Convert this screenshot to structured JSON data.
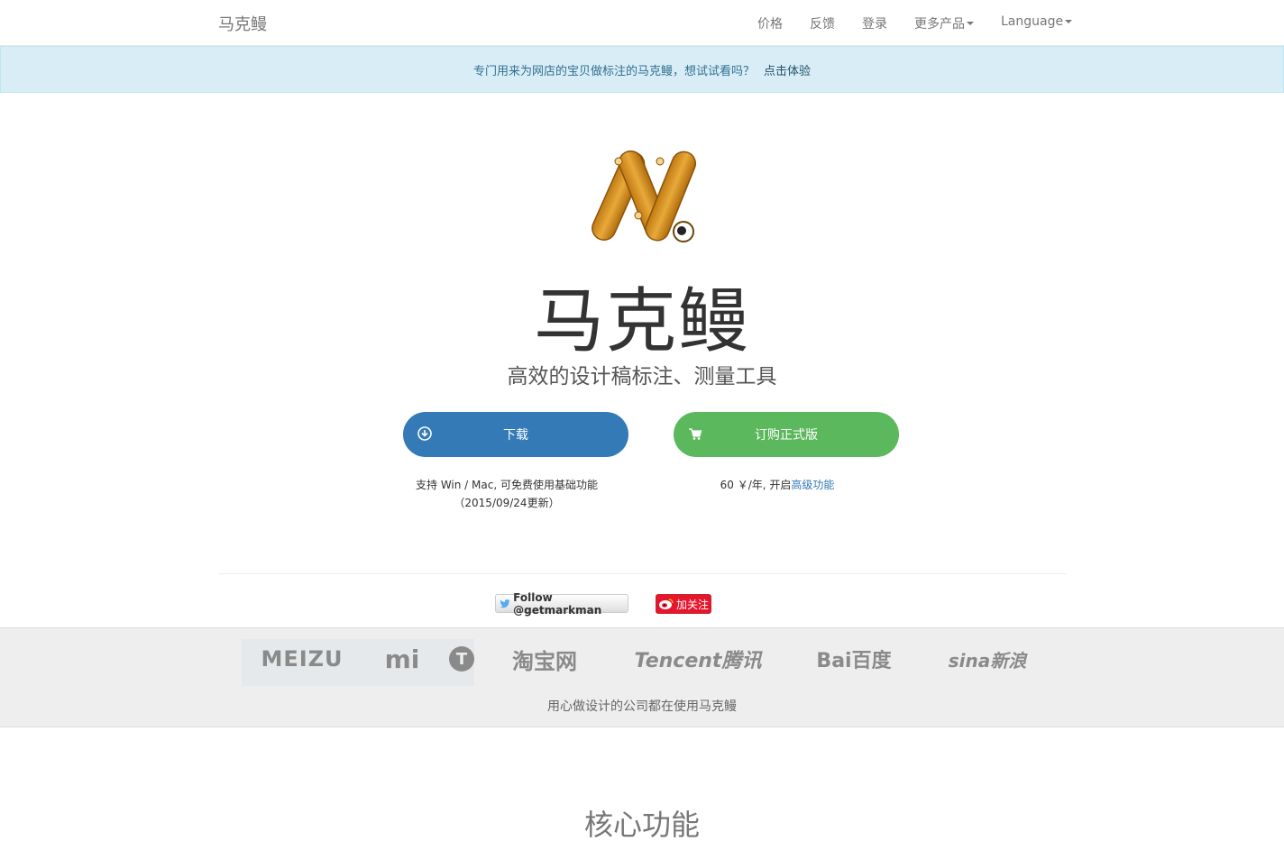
{
  "navbar": {
    "brand": "马克鳗",
    "items": [
      {
        "label": "价格"
      },
      {
        "label": "反馈"
      },
      {
        "label": "登录"
      },
      {
        "label": "更多产品"
      },
      {
        "label": "Language"
      }
    ]
  },
  "alert": {
    "text": "专门用来为网店的宝贝做标注的马克鳗，想试试看吗？",
    "link": "点击体验"
  },
  "hero": {
    "app_name": "马克鳗",
    "tagline": "高效的设计稿标注、测量工具",
    "download_label": "下载",
    "buy_label": "订购正式版",
    "download_note_line1": "支持 Win / Mac, 可免费使用基础功能",
    "download_note_line2": "（2015/09/24更新）",
    "buy_note_prefix": "60 ￥/年, 开启",
    "buy_note_link": "高级功能"
  },
  "social": {
    "twitter_label": "Follow @getmarkman",
    "weibo_label": "加关注"
  },
  "clients": {
    "logos": [
      "MEIZU",
      "mi",
      "T",
      "淘宝网",
      "Tencent腾讯",
      "Bai百度",
      "sina新浪"
    ],
    "caption": "用心做设计的公司都在使用马克鳗"
  },
  "section": {
    "title": "核心功能"
  },
  "colors": {
    "download_button": "#337ab7",
    "buy_button": "#5cb85c",
    "alert_background": "#d9edf7",
    "alert_text": "#31708f"
  },
  "icons": {
    "download": "download-circle-icon",
    "cart": "shopping-cart-icon",
    "twitter": "twitter-bird-icon",
    "weibo": "weibo-icon",
    "logo": "markman-ruler-m-logo"
  }
}
